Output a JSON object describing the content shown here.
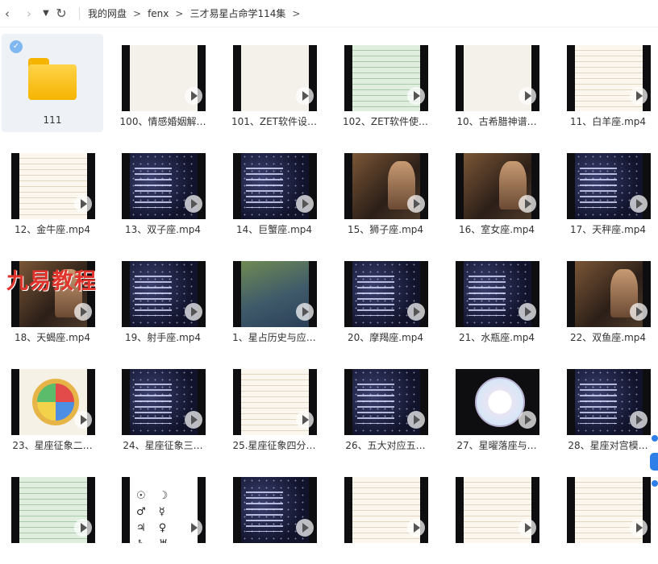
{
  "nav": {
    "back_icon": "‹",
    "forward_icon": "›",
    "dropdown_icon": "▼",
    "refresh_icon": "↻"
  },
  "breadcrumb": [
    "我的网盘",
    "fenx",
    "三才易星占命学114集"
  ],
  "breadcrumb_separator": ">",
  "folder": {
    "name": "111"
  },
  "files": [
    {
      "name": "100、情感婚姻解…",
      "style": "light"
    },
    {
      "name": "101、ZET软件设…",
      "style": "light"
    },
    {
      "name": "102、ZET软件使…",
      "style": "green"
    },
    {
      "name": "10、古希腊神谱…",
      "style": "light"
    },
    {
      "name": "11、白羊座.mp4",
      "style": "table"
    },
    {
      "name": "12、金牛座.mp4",
      "style": "table"
    },
    {
      "name": "13、双子座.mp4",
      "style": "space"
    },
    {
      "name": "14、巨蟹座.mp4",
      "style": "space"
    },
    {
      "name": "15、狮子座.mp4",
      "style": "art"
    },
    {
      "name": "16、室女座.mp4",
      "style": "art"
    },
    {
      "name": "17、天秤座.mp4",
      "style": "space"
    },
    {
      "name": "18、天蝎座.mp4",
      "style": "art"
    },
    {
      "name": "19、射手座.mp4",
      "style": "space"
    },
    {
      "name": "1、星占历史与应…",
      "style": "map"
    },
    {
      "name": "20、摩羯座.mp4",
      "style": "space"
    },
    {
      "name": "21、水瓶座.mp4",
      "style": "space"
    },
    {
      "name": "22、双鱼座.mp4",
      "style": "art"
    },
    {
      "name": "23、星座征象二…",
      "style": "wheel"
    },
    {
      "name": "24、星座征象三…",
      "style": "space"
    },
    {
      "name": "25.星座征象四分…",
      "style": "table"
    },
    {
      "name": "26、五大对应五…",
      "style": "space"
    },
    {
      "name": "27、星曜落座与…",
      "style": "wheel2"
    },
    {
      "name": "28、星座对宫模…",
      "style": "space"
    },
    {
      "name": "",
      "style": "green"
    },
    {
      "name": "",
      "style": "symbols"
    },
    {
      "name": "",
      "style": "space"
    },
    {
      "name": "",
      "style": "table"
    },
    {
      "name": "",
      "style": "table"
    },
    {
      "name": "",
      "style": "table"
    }
  ],
  "watermark": "九易教程",
  "check_glyph": "✓",
  "symbol_glyphs": "☉ ☽ ♂ ☿ ♃ ♀ ♄ ♅ ♆"
}
